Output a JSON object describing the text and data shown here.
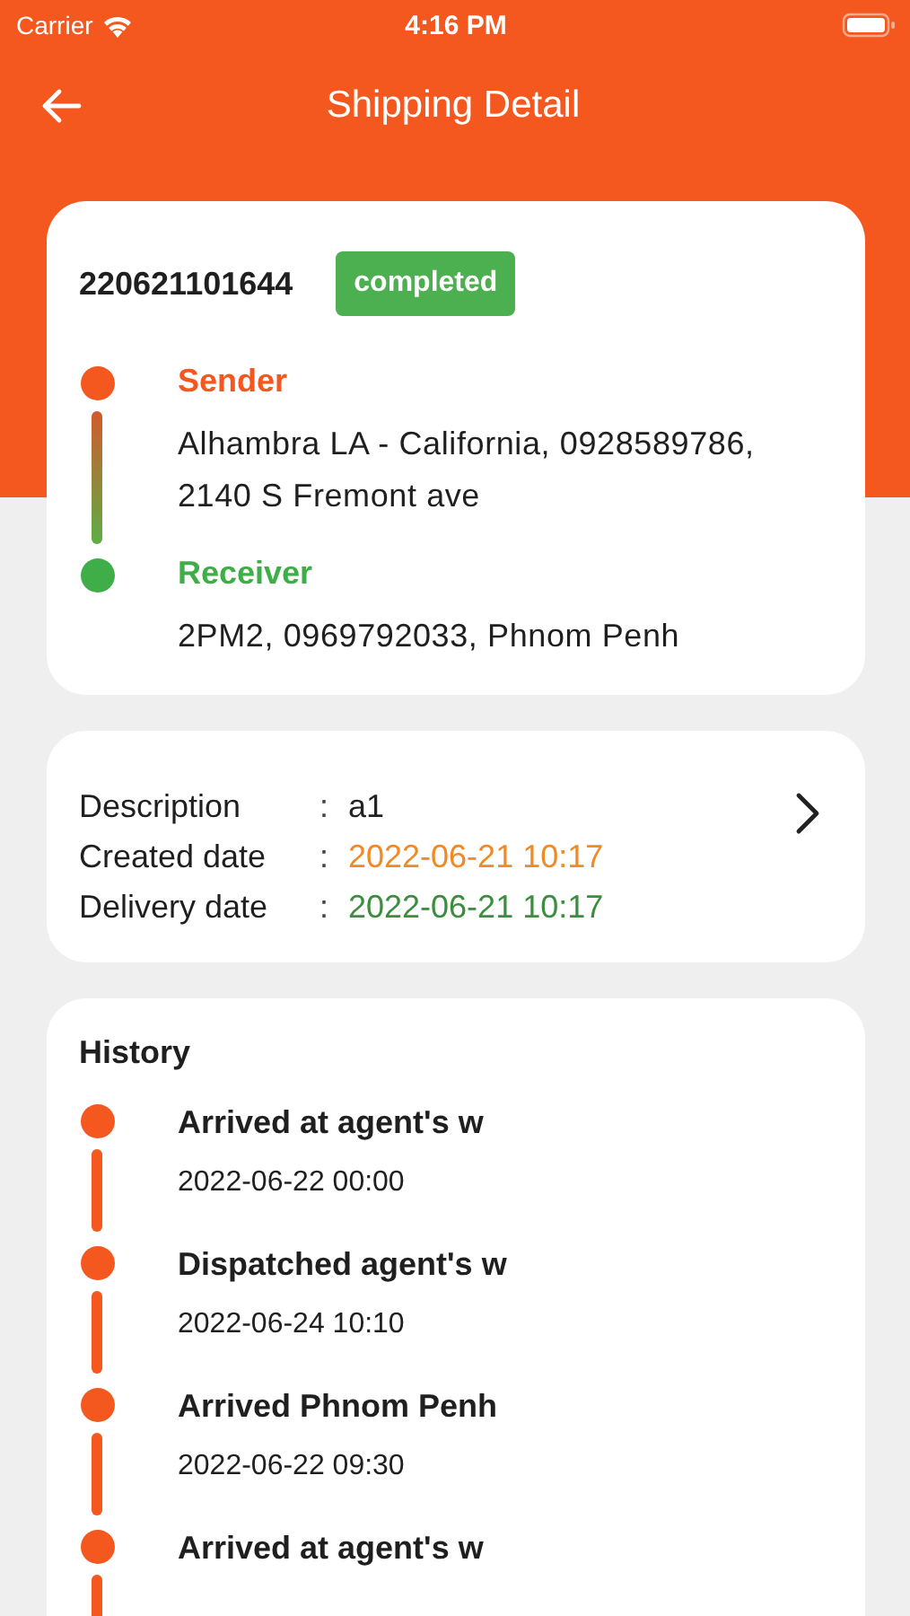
{
  "status_bar": {
    "carrier": "Carrier",
    "time": "4:16 PM"
  },
  "nav": {
    "title": "Shipping Detail"
  },
  "shipment": {
    "number": "220621101644",
    "status": "completed",
    "parties": [
      {
        "kind": "sender",
        "label": "Sender",
        "address": "Alhambra LA - California, 0928589786, 2140 S Fremont ave"
      },
      {
        "kind": "receiver",
        "label": "Receiver",
        "address": "2PM2, 0969792033, Phnom Penh"
      }
    ]
  },
  "info": {
    "rows": [
      {
        "label": "Description",
        "separator": ":",
        "value": "a1",
        "color": "#222222"
      },
      {
        "label": "Created date",
        "separator": ":",
        "value": "2022-06-21 10:17",
        "color": "#ef8a25"
      },
      {
        "label": "Delivery date",
        "separator": ":",
        "value": "2022-06-21 10:17",
        "color": "#3a8e3e"
      }
    ]
  },
  "history": {
    "title": "History",
    "events": [
      {
        "title": "Arrived at agent's w",
        "date": "2022-06-22 00:00"
      },
      {
        "title": "Dispatched agent's w",
        "date": "2022-06-24 10:10"
      },
      {
        "title": "Arrived Phnom Penh",
        "date": "2022-06-22 09:30"
      },
      {
        "title": "Arrived at agent's w"
      }
    ]
  }
}
